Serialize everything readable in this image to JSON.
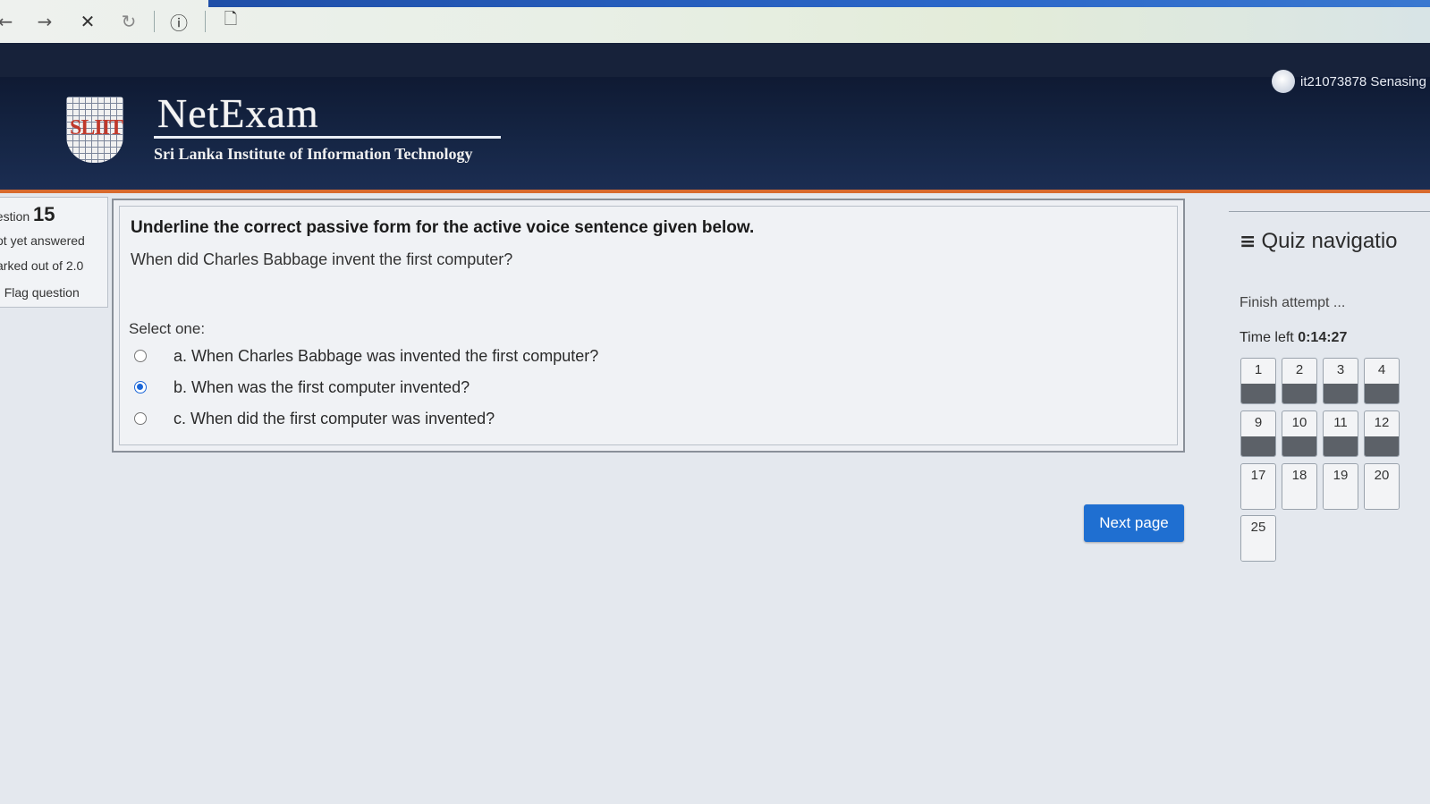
{
  "browser": {
    "back_icon": "←",
    "forward_icon": "→",
    "stop_icon": "✕",
    "reload_icon": "↻",
    "info_icon": "ⓘ",
    "page_icon": "🗋"
  },
  "header": {
    "user_label": "it21073878 Senasing",
    "logo_text": "SLIIT",
    "brand_title": "NetExam",
    "brand_subtitle": "Sri Lanka Institute of Information Technology"
  },
  "question_info": {
    "label": "uestion",
    "number": "15",
    "state": "ot yet answered",
    "marks": "arked out of 2.0",
    "flag_label": "Flag question",
    "flag_icon": "'"
  },
  "question": {
    "prompt": "Underline the correct passive form for the active voice sentence given below.",
    "sentence": "When did Charles Babbage invent the first computer?",
    "select_label": "Select one:",
    "options": [
      {
        "label": "a. When Charles Babbage was invented the first computer?",
        "checked": false
      },
      {
        "label": "b. When was the first computer invented?",
        "checked": true
      },
      {
        "label": "c. When did the first computer was invented?",
        "checked": false
      }
    ]
  },
  "next_button": "Next page",
  "quiz_nav": {
    "title": "Quiz navigatio",
    "finish_link": "Finish attempt ...",
    "time_label": "Time left",
    "time_value": "0:14:27",
    "buttons": [
      {
        "label": "1",
        "answered": true
      },
      {
        "label": "2",
        "answered": true
      },
      {
        "label": "3",
        "answered": true
      },
      {
        "label": "4",
        "answered": true
      },
      {
        "label": "9",
        "answered": true
      },
      {
        "label": "10",
        "answered": true
      },
      {
        "label": "11",
        "answered": true
      },
      {
        "label": "12",
        "answered": true
      },
      {
        "label": "17",
        "answered": false
      },
      {
        "label": "18",
        "answered": false
      },
      {
        "label": "19",
        "answered": false
      },
      {
        "label": "20",
        "answered": false
      },
      {
        "label": "25",
        "answered": false
      }
    ]
  }
}
